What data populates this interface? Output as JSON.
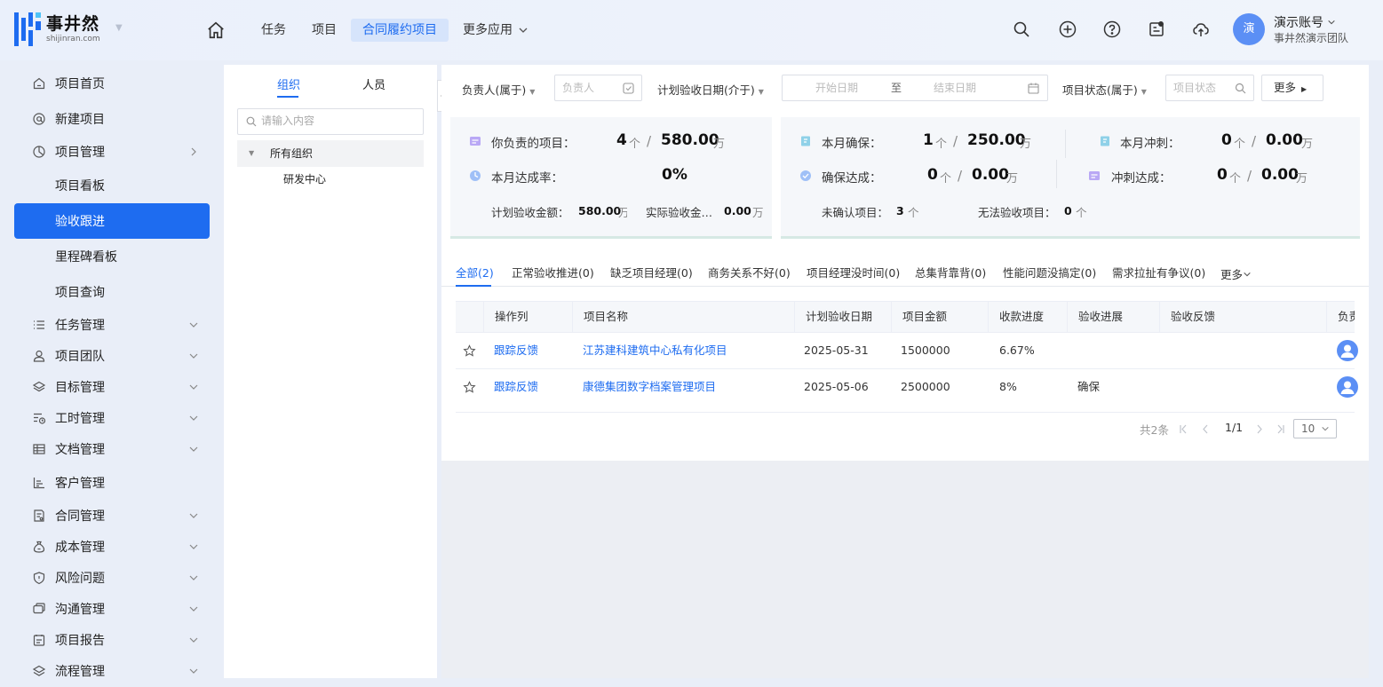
{
  "app": {
    "logo_cn": "事井然",
    "logo_en": "shijinran.com"
  },
  "nav": {
    "items": [
      "任务",
      "项目",
      "合同履约项目",
      "更多应用"
    ],
    "active_index": 2
  },
  "account": {
    "avatar_text": "演",
    "name": "演示账号",
    "team": "事井然演示团队"
  },
  "sidebar": {
    "items": [
      {
        "label": "项目首页",
        "icon": "home-outline-icon"
      },
      {
        "label": "新建项目",
        "icon": "at-icon"
      },
      {
        "label": "项目管理",
        "icon": "pie-icon"
      },
      {
        "label": "项目看板",
        "icon": ""
      },
      {
        "label": "验收跟进",
        "icon": ""
      },
      {
        "label": "里程碑看板",
        "icon": ""
      },
      {
        "label": "项目查询",
        "icon": ""
      },
      {
        "label": "任务管理",
        "icon": "list-icon"
      },
      {
        "label": "项目团队",
        "icon": "user-icon"
      },
      {
        "label": "目标管理",
        "icon": "layers-icon"
      },
      {
        "label": "工时管理",
        "icon": "timesheet-icon"
      },
      {
        "label": "文档管理",
        "icon": "table-icon"
      },
      {
        "label": "客户管理",
        "icon": "chart-icon"
      },
      {
        "label": "合同管理",
        "icon": "contract-icon"
      },
      {
        "label": "成本管理",
        "icon": "money-bag-icon"
      },
      {
        "label": "风险问题",
        "icon": "shield-icon"
      },
      {
        "label": "沟通管理",
        "icon": "chat-icon"
      },
      {
        "label": "项目报告",
        "icon": "report-icon"
      },
      {
        "label": "流程管理",
        "icon": "flow-icon"
      }
    ],
    "active_index": 4
  },
  "org": {
    "tabs": [
      "组织",
      "人员"
    ],
    "search_placeholder": "请输入内容",
    "root": "所有组织",
    "child": "研发中心"
  },
  "filters": {
    "owner_label": "负责人(属于)",
    "owner_placeholder": "负责人",
    "date_label": "计划验收日期(介于)",
    "start_placeholder": "开始日期",
    "to": "至",
    "end_placeholder": "结束日期",
    "status_label": "项目状态(属于)",
    "status_placeholder": "项目状态",
    "more": "更多"
  },
  "stats": {
    "my_projects_label": "你负责的项目：",
    "my_projects_count": "4",
    "my_projects_amount": "580.00",
    "month_rate_label": "本月达成率：",
    "month_rate": "0%",
    "plan_amount_label": "计划验收金额：",
    "plan_amount": "580.00",
    "actual_amount_label": "实际验收金…",
    "actual_amount": "0.00",
    "secure_label": "本月确保：",
    "secure_count": "1",
    "secure_amount": "250.00",
    "sprint_label": "本月冲刺：",
    "sprint_count": "0",
    "sprint_amount": "0.00",
    "secure_done_label": "确保达成：",
    "secure_done_count": "0",
    "secure_done_amount": "0.00",
    "sprint_done_label": "冲刺达成：",
    "sprint_done_count": "0",
    "sprint_done_amount": "0.00",
    "unconfirmed_label": "未确认项目：",
    "unconfirmed": "3",
    "unable_label": "无法验收项目：",
    "unable": "0",
    "unit_ge": "个",
    "unit_wan": "万",
    "slash": "/"
  },
  "tabs": [
    "全部(2)",
    "正常验收推进(0)",
    "缺乏项目经理(0)",
    "商务关系不好(0)",
    "项目经理没时间(0)",
    "总集背靠背(0)",
    "性能问题没搞定(0)",
    "需求拉扯有争议(0)",
    "更多"
  ],
  "table": {
    "columns": [
      "操作列",
      "项目名称",
      "计划验收日期",
      "项目金额",
      "收款进度",
      "验收进展",
      "验收反馈",
      "负责"
    ],
    "rows": [
      {
        "action": "跟踪反馈",
        "name": "江苏建科建筑中心私有化项目",
        "date": "2025-05-31",
        "amount": "1500000",
        "progress": "6.67%",
        "status": "",
        "feedback": ""
      },
      {
        "action": "跟踪反馈",
        "name": "康德集团数字档案管理项目",
        "date": "2025-05-06",
        "amount": "2500000",
        "progress": "8%",
        "status": "确保",
        "feedback": ""
      }
    ]
  },
  "pager": {
    "total": "共2条",
    "page": "1/1",
    "size": "10"
  },
  "colors": {
    "accent": "#1e6cf0"
  }
}
